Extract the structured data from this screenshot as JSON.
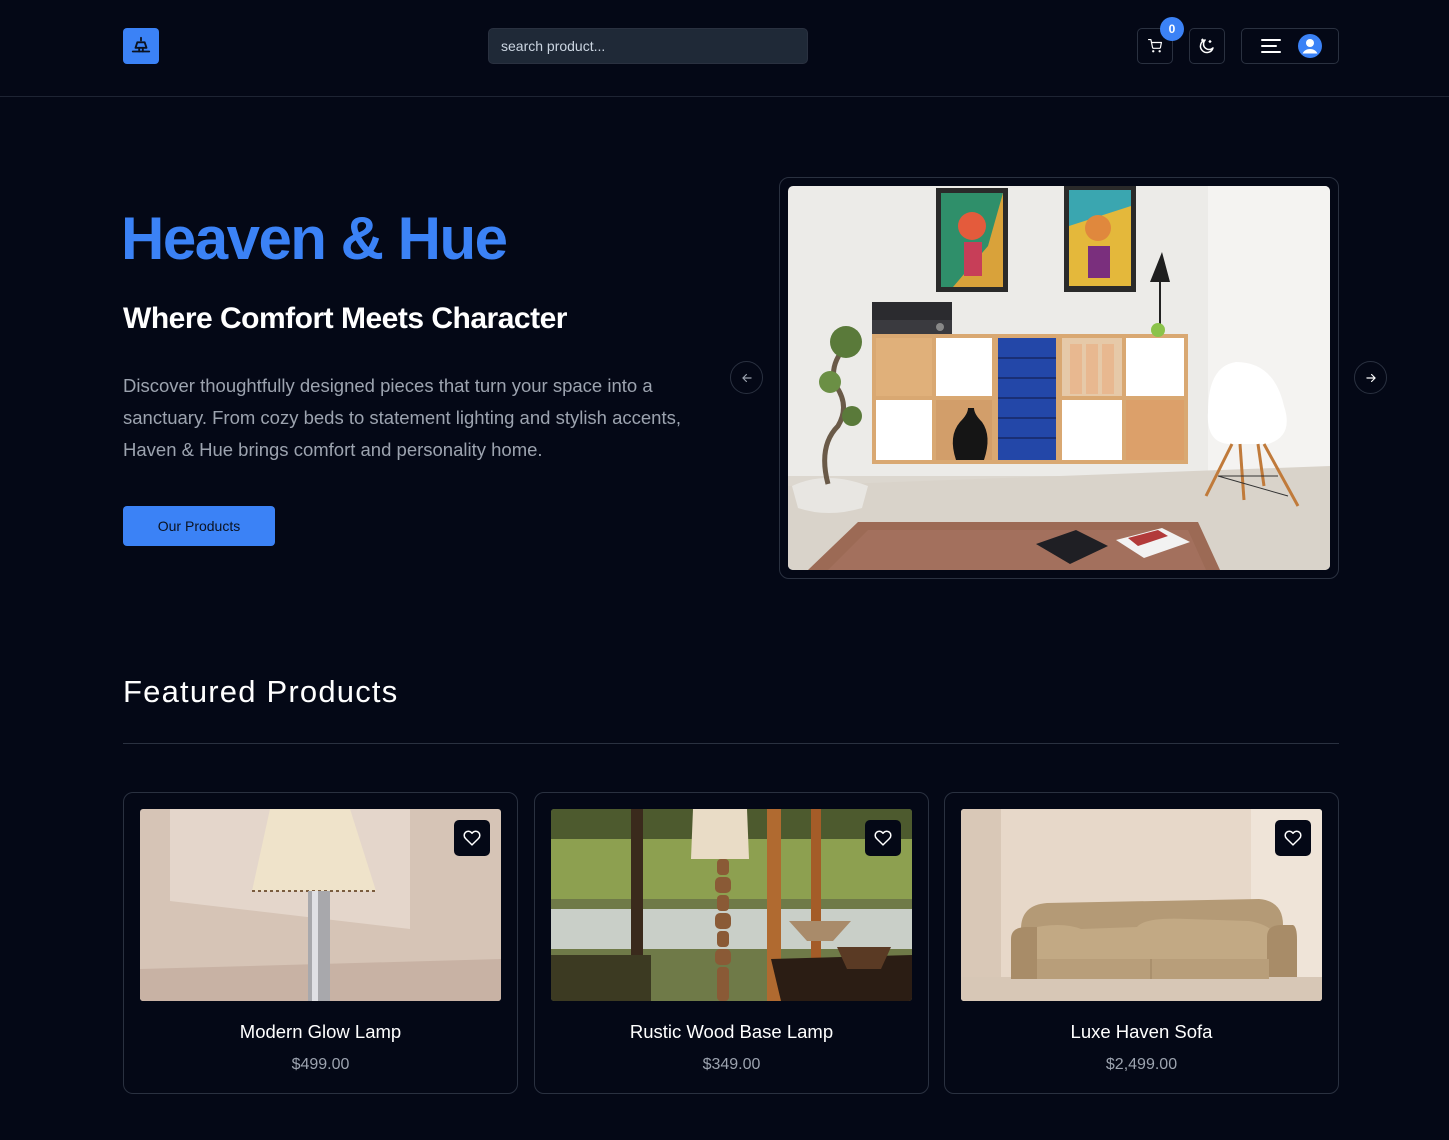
{
  "header": {
    "search_placeholder": "search product...",
    "cart_count": "0",
    "icons": {
      "logo": "lamp-icon",
      "cart": "cart-icon",
      "theme": "moon-icon",
      "menu": "menu-icon",
      "profile": "user-avatar-icon"
    }
  },
  "hero": {
    "title": "Heaven & Hue",
    "subtitle": "Where Comfort Meets Character",
    "description": "Discover thoughtfully designed pieces that turn your space into a sanctuary. From cozy beds to statement lighting and stylish accents, Haven & Hue brings comfort and personality home.",
    "cta_label": "Our Products",
    "carousel": {
      "prev_icon": "arrow-left-icon",
      "next_icon": "arrow-right-icon"
    }
  },
  "featured": {
    "title": "Featured Products",
    "products": [
      {
        "name": "Modern Glow Lamp",
        "price": "$499.00"
      },
      {
        "name": "Rustic Wood Base Lamp",
        "price": "$349.00"
      },
      {
        "name": "Luxe Haven Sofa",
        "price": "$2,499.00"
      }
    ]
  },
  "colors": {
    "background": "#040816",
    "accent": "#3b82f6",
    "border": "#2a3140",
    "muted_text": "#9ca3af"
  }
}
